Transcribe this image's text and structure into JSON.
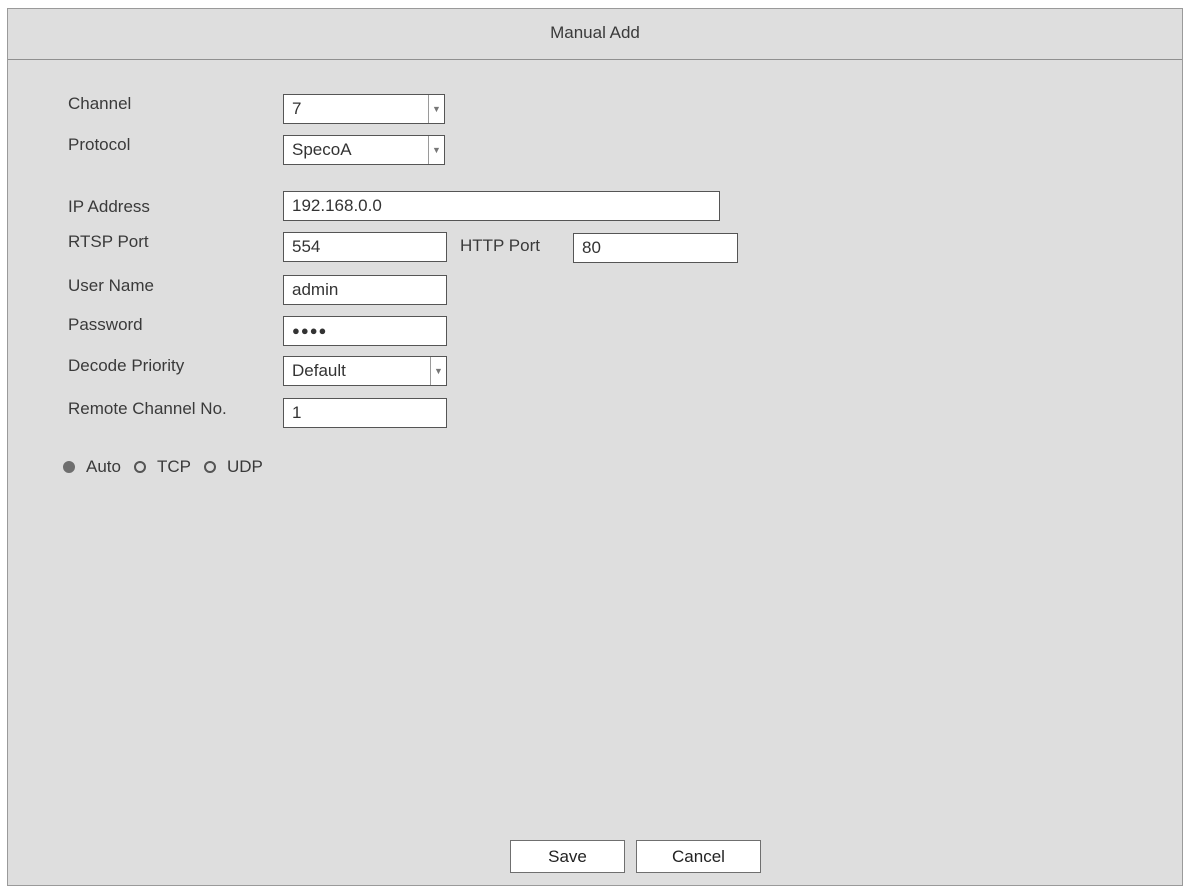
{
  "dialog": {
    "title": "Manual Add"
  },
  "form": {
    "channel": {
      "label": "Channel",
      "value": "7"
    },
    "protocol": {
      "label": "Protocol",
      "value": "SpecoA"
    },
    "ip_address": {
      "label": "IP Address",
      "value": "192.168.0.0"
    },
    "rtsp_port": {
      "label": "RTSP Port",
      "value": "554"
    },
    "http_port": {
      "label": "HTTP Port",
      "value": "80"
    },
    "user_name": {
      "label": "User Name",
      "value": "admin"
    },
    "password": {
      "label": "Password",
      "value": "●●●●"
    },
    "decode_priority": {
      "label": "Decode Priority",
      "value": "Default"
    },
    "remote_channel": {
      "label": "Remote Channel No.",
      "value": "1"
    }
  },
  "transport": {
    "options": [
      "Auto",
      "TCP",
      "UDP"
    ],
    "selected": "Auto"
  },
  "buttons": {
    "save": "Save",
    "cancel": "Cancel"
  },
  "icons": {
    "dropdown": "chevron-down-icon"
  }
}
